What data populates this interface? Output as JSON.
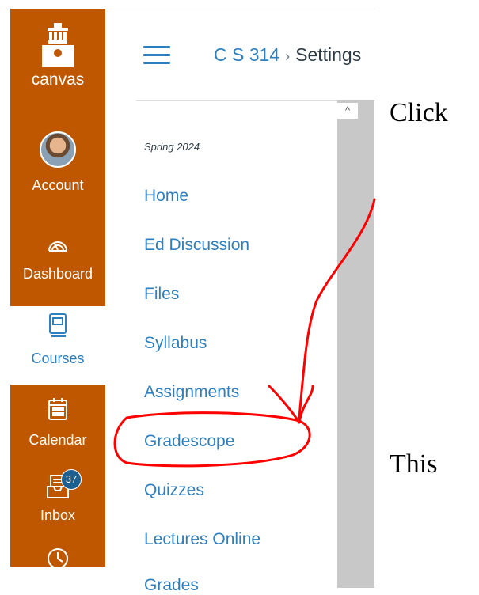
{
  "global_nav": {
    "logo_label": "canvas",
    "items": [
      {
        "label": "Account",
        "icon": "avatar"
      },
      {
        "label": "Dashboard",
        "icon": "dashboard-icon"
      },
      {
        "label": "Courses",
        "icon": "courses-icon"
      },
      {
        "label": "Calendar",
        "icon": "calendar-icon"
      },
      {
        "label": "Inbox",
        "icon": "inbox-icon",
        "badge": "37"
      },
      {
        "label": "",
        "icon": "history-icon"
      }
    ]
  },
  "breadcrumb": {
    "course": "C S 314",
    "separator": "›",
    "current": "Settings"
  },
  "course_nav": {
    "term": "Spring 2024",
    "links": [
      "Home",
      "Ed Discussion",
      "Files",
      "Syllabus",
      "Assignments",
      "Gradescope",
      "Quizzes",
      "Lectures Online",
      "Grades"
    ]
  },
  "annotation_text": {
    "top": "Click",
    "bottom": "This"
  },
  "colors": {
    "brand": "#bf5700",
    "link": "#2d7fbd",
    "annotation": "#ff0000"
  }
}
